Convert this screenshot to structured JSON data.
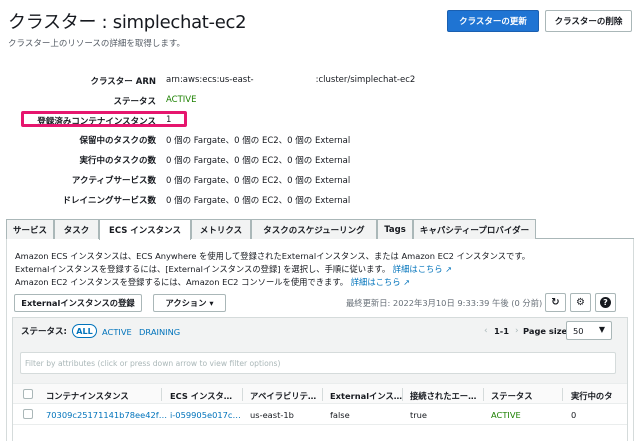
{
  "header": {
    "title": "クラスター : simplechat-ec2",
    "subtitle": "クラスター上のリソースの詳細を取得します。",
    "update_button": "クラスターの更新",
    "delete_button": "クラスターの削除"
  },
  "details": {
    "arn_label": "クラスター ARN",
    "arn_prefix": "arn:aws:ecs:us-east-",
    "arn_suffix": ":cluster/simplechat-ec2",
    "status_label": "ステータス",
    "status_value": "ACTIVE",
    "registered_label": "登録済みコンテナインスタンス",
    "registered_value": "1",
    "pending_label": "保留中のタスクの数",
    "pending_value": "0 個の Fargate、0 個の EC2、0 個の External",
    "running_label": "実行中のタスクの数",
    "running_value": "0 個の Fargate、0 個の EC2、0 個の External",
    "active_services_label": "アクティブサービス数",
    "active_services_value": "0 個の Fargate、0 個の EC2、0 個の External",
    "draining_services_label": "ドレイニングサービス数",
    "draining_services_value": "0 個の Fargate、0 個の EC2、0 個の External"
  },
  "tabs": [
    {
      "label": "サービス"
    },
    {
      "label": "タスク"
    },
    {
      "label": "ECS インスタンス"
    },
    {
      "label": "メトリクス"
    },
    {
      "label": "タスクのスケジューリング"
    },
    {
      "label": "Tags"
    },
    {
      "label": "キャパシティープロバイダー"
    }
  ],
  "active_tab": "ECS インスタンス",
  "info": {
    "line1": "Amazon ECS インスタンスは、ECS Anywhere を使用して登録されたExternalインスタンス、または Amazon EC2 インスタンスです。",
    "line2": "Externalインスタンスを登録するには、[Externalインスタンスの登録] を選択し、手順に従います。",
    "line2_link": "詳細はこちら",
    "line3": "Amazon EC2 インスタンスを登録するには、Amazon EC2 コンソールを使用できます。",
    "line3_link": "詳細はこちら"
  },
  "toolbar": {
    "register_external": "Externalインスタンスの登録",
    "actions": "アクション ▾",
    "last_updated": "最終更新日: 2022年3月10日 9:33:39 午後 (0 分前)"
  },
  "filters": {
    "status_label": "ステータス:",
    "all": "ALL",
    "active": "ACTIVE",
    "draining": "DRAINING",
    "pager_prev": "‹",
    "pager_range": "1-1",
    "pager_next": "›",
    "page_size_label": "Page size",
    "page_size_value": "50",
    "search_placeholder": "Filter by attributes (click or press down arrow to view filter options)"
  },
  "table": {
    "columns": [
      "コンテナインスタンス",
      "ECS インスタ…",
      "アベイラビリテ…",
      "Externalインス…",
      "接続されたエー…",
      "ステータス",
      "実行中のタ"
    ],
    "rows": [
      [
        "70309c25171141b78ee42f…",
        "i-059905e017c…",
        "us-east-1b",
        "false",
        "true",
        "ACTIVE",
        "0"
      ]
    ]
  },
  "colors": {
    "primary": "#1f74d3",
    "link": "#0073bb",
    "active": "#1d8102",
    "highlight": "#e6166e"
  }
}
